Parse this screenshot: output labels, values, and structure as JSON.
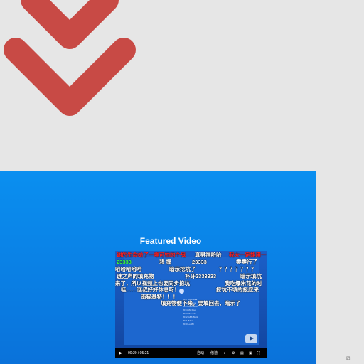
{
  "colors": {
    "background": "#e6e6e6",
    "accent": "#c84a45",
    "panel": "#0a8ff0"
  },
  "featured": {
    "title": "Featured Video"
  },
  "danmaku": {
    "line1_red": "谢的生命给了一堆可怕的个鬼",
    "line1_white": "真男神哈哈",
    "line1_red2": "我大一定能用一",
    "line2_green": "23333",
    "line2_a": "悲 握",
    "line2_b": "23333",
    "line2_c": "零零行了",
    "line3_a": "哈哈哈哈哈",
    "line3_b": "暗示挖坑了",
    "line3_c": "？？？？？？？",
    "line4_a": "谜之声的填充物",
    "line4_b": "补牙2333333",
    "line4_c": "暗示填坑",
    "line5_a": "来了，所以视频上也要同步挖坑",
    "line5_b": "我吃爆米花的时",
    "line6_a": "哇……谜叔好好休息呀！",
    "line6_b": "挖坑不填的报应来",
    "line7_a": "南猫基特！！！",
    "line8_a": "填充物便下来，要填回去，暗示了"
  },
  "screen_list": [
    "2017 GB6 Mira",
    "2016 NE Blue",
    "2015 GB6 Stick",
    "2014 MA Pool",
    "2013 RU Hold",
    "2012 GB6 Block",
    "2011 BAlus",
    "2010 Lok80"
  ],
  "player": {
    "time": "00:20 / 05:21",
    "quality": "自动",
    "speed": "倍速",
    "play_icon": "play-icon",
    "volume_icon": "volume-icon",
    "settings_icon": "settings-icon",
    "danmaku_icon": "danmaku-icon",
    "fullscreen_icon": "fullscreen-icon"
  },
  "icons": {
    "chevron": "double-chevron-down-icon",
    "corner": "copy-icon"
  }
}
